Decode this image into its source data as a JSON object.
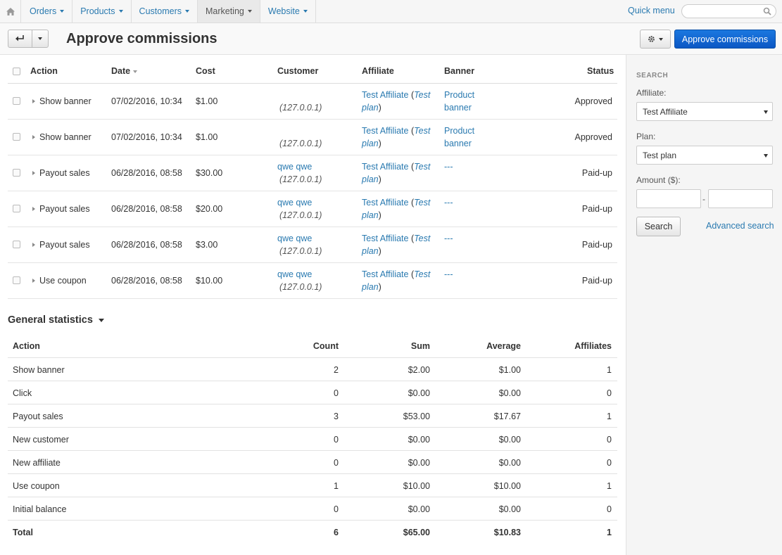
{
  "nav": {
    "home_icon": "home-icon",
    "items": [
      {
        "label": "Orders"
      },
      {
        "label": "Products"
      },
      {
        "label": "Customers"
      },
      {
        "label": "Marketing"
      },
      {
        "label": "Website"
      }
    ],
    "quick_menu": "Quick menu",
    "search_placeholder": ""
  },
  "header": {
    "title": "Approve commissions",
    "approve_button": "Approve commissions"
  },
  "commissions": {
    "columns": {
      "action": "Action",
      "date": "Date",
      "cost": "Cost",
      "customer": "Customer",
      "affiliate": "Affiliate",
      "banner": "Banner",
      "status": "Status"
    },
    "rows": [
      {
        "action": "Show banner",
        "date": "07/02/2016, 10:34",
        "cost": "$1.00",
        "customer_name": "",
        "customer_ip": "(127.0.0.1)",
        "affiliate": "Test Affiliate",
        "plan_open": " (",
        "plan": "Test",
        "plan2": "plan",
        "plan_close": ")",
        "banner1": "Product",
        "banner2": "banner",
        "status": "Approved"
      },
      {
        "action": "Show banner",
        "date": "07/02/2016, 10:34",
        "cost": "$1.00",
        "customer_name": "",
        "customer_ip": "(127.0.0.1)",
        "affiliate": "Test Affiliate",
        "plan_open": " (",
        "plan": "Test",
        "plan2": "plan",
        "plan_close": ")",
        "banner1": "Product",
        "banner2": "banner",
        "status": "Approved"
      },
      {
        "action": "Payout sales",
        "date": "06/28/2016, 08:58",
        "cost": "$30.00",
        "customer_name": "qwe qwe",
        "customer_ip": "(127.0.0.1)",
        "affiliate": "Test Affiliate",
        "plan_open": " (",
        "plan": "Test",
        "plan2": "plan",
        "plan_close": ")",
        "banner1": "---",
        "banner2": "",
        "status": "Paid-up"
      },
      {
        "action": "Payout sales",
        "date": "06/28/2016, 08:58",
        "cost": "$20.00",
        "customer_name": "qwe qwe",
        "customer_ip": "(127.0.0.1)",
        "affiliate": "Test Affiliate",
        "plan_open": " (",
        "plan": "Test",
        "plan2": "plan",
        "plan_close": ")",
        "banner1": "---",
        "banner2": "",
        "status": "Paid-up"
      },
      {
        "action": "Payout sales",
        "date": "06/28/2016, 08:58",
        "cost": "$3.00",
        "customer_name": "qwe qwe",
        "customer_ip": "(127.0.0.1)",
        "affiliate": "Test Affiliate",
        "plan_open": " (",
        "plan": "Test",
        "plan2": "plan",
        "plan_close": ")",
        "banner1": "---",
        "banner2": "",
        "status": "Paid-up"
      },
      {
        "action": "Use coupon",
        "date": "06/28/2016, 08:58",
        "cost": "$10.00",
        "customer_name": "qwe qwe",
        "customer_ip": "(127.0.0.1)",
        "affiliate": "Test Affiliate",
        "plan_open": " (",
        "plan": "Test",
        "plan2": "plan",
        "plan_close": ")",
        "banner1": "---",
        "banner2": "",
        "status": "Paid-up"
      }
    ]
  },
  "statistics": {
    "title": "General statistics",
    "columns": {
      "action": "Action",
      "count": "Count",
      "sum": "Sum",
      "average": "Average",
      "affiliates": "Affiliates"
    },
    "rows": [
      {
        "action": "Show banner",
        "count": "2",
        "sum": "$2.00",
        "average": "$1.00",
        "affiliates": "1"
      },
      {
        "action": "Click",
        "count": "0",
        "sum": "$0.00",
        "average": "$0.00",
        "affiliates": "0"
      },
      {
        "action": "Payout sales",
        "count": "3",
        "sum": "$53.00",
        "average": "$17.67",
        "affiliates": "1"
      },
      {
        "action": "New customer",
        "count": "0",
        "sum": "$0.00",
        "average": "$0.00",
        "affiliates": "0"
      },
      {
        "action": "New affiliate",
        "count": "0",
        "sum": "$0.00",
        "average": "$0.00",
        "affiliates": "0"
      },
      {
        "action": "Use coupon",
        "count": "1",
        "sum": "$10.00",
        "average": "$10.00",
        "affiliates": "1"
      },
      {
        "action": "Initial balance",
        "count": "0",
        "sum": "$0.00",
        "average": "$0.00",
        "affiliates": "0"
      }
    ],
    "total": {
      "action": "Total",
      "count": "6",
      "sum": "$65.00",
      "average": "$10.83",
      "affiliates": "1"
    }
  },
  "sidebar": {
    "heading": "SEARCH",
    "affiliate_label": "Affiliate:",
    "affiliate_value": "Test Affiliate",
    "plan_label": "Plan:",
    "plan_value": "Test plan",
    "amount_label": "Amount ($):",
    "amount_separator": "-",
    "search_button": "Search",
    "advanced_search": "Advanced search"
  },
  "colors": {
    "link": "#2a7ab0",
    "primary_button": "#0b57c4"
  }
}
